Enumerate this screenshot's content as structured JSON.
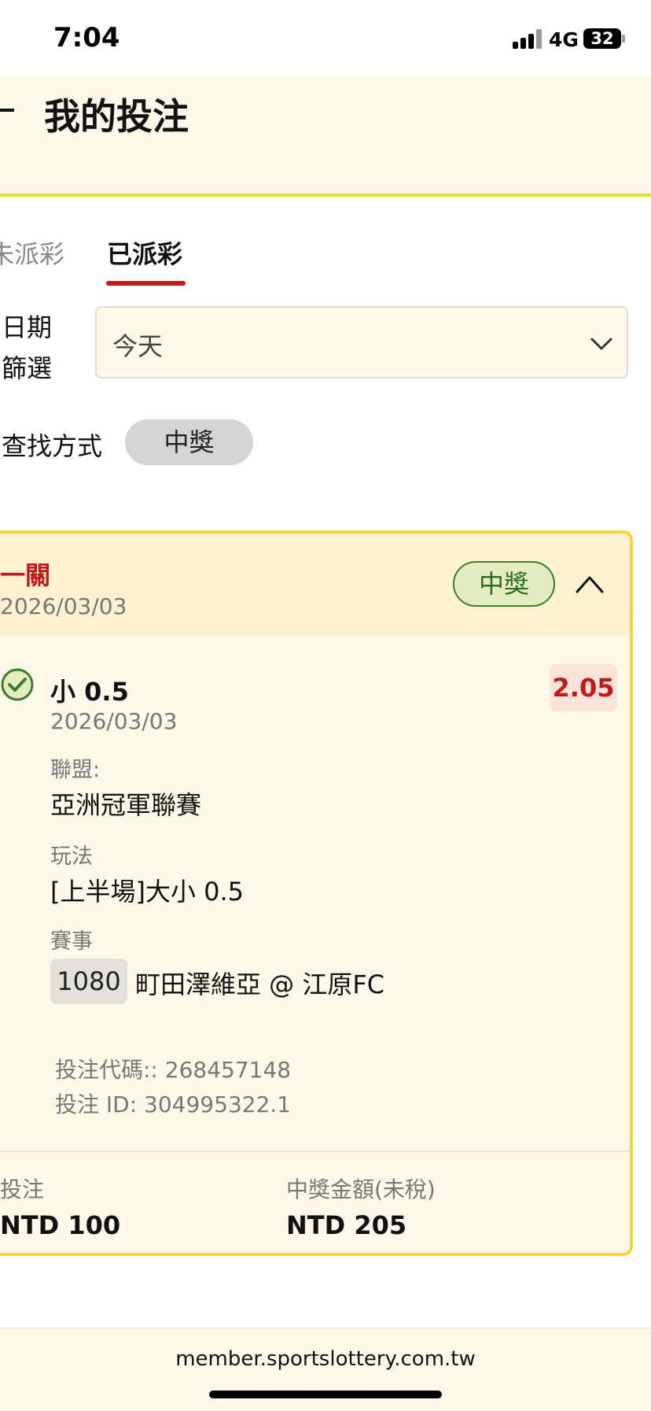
{
  "status_bar": {
    "time": "7:04",
    "network": "4G",
    "battery": "32"
  },
  "header": {
    "title": "我的投注"
  },
  "tabs": [
    {
      "label": "未派彩",
      "active": false
    },
    {
      "label": "已派彩",
      "active": true
    }
  ],
  "filters": {
    "date_label": "日期篩選",
    "date_value": "今天",
    "search_label": "查找方式",
    "search_chip": "中獎"
  },
  "bet": {
    "type": "一關",
    "date": "2026/03/03",
    "status": "中獎",
    "selection": "小 0.5",
    "selection_date": "2026/03/03",
    "odds": "2.05",
    "league_label": "聯盟:",
    "league": "亞洲冠軍聯賽",
    "play_label": "玩法",
    "play": "[上半場]大小 0.5",
    "match_label": "賽事",
    "match_number": "1080",
    "match": "町田澤維亞 @ 江原FC",
    "bet_code": "投注代碼:: 268457148",
    "bet_id": "投注 ID: 304995322.1",
    "stake_label": "投注",
    "stake": "NTD 100",
    "payout_label": "中獎金額(未稅)",
    "payout": "NTD 205"
  },
  "browser": {
    "domain": "member.sportslottery.com.tw"
  },
  "colors": {
    "accent_yellow": "#f5d53a",
    "accent_red": "#c21a1a",
    "win_green": "#2f6e22"
  }
}
